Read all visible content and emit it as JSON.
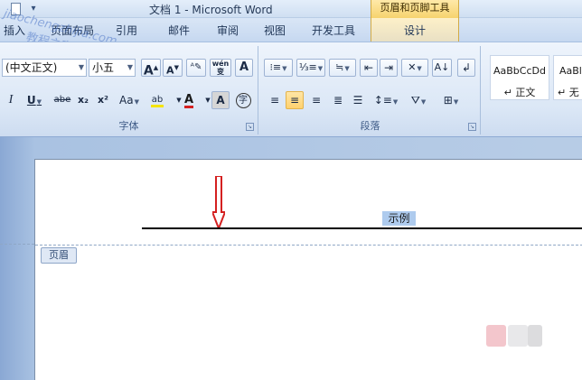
{
  "window": {
    "title": "文档 1 - Microsoft Word",
    "context_title": "页眉和页脚工具",
    "watermark_line1": "jiaochengzhijia.com",
    "watermark_line2": "教程之家"
  },
  "tabs": [
    "插入",
    "页面布局",
    "引用",
    "邮件",
    "审阅",
    "视图",
    "开发工具"
  ],
  "context_tab": "设计",
  "font_group": {
    "font_name": "(中文正文)",
    "font_size": "小五",
    "label": "字体",
    "grow_label": "A",
    "shrink_label": "A",
    "phonetic_label": "wén",
    "border_char_label": "A",
    "italic": "I",
    "underline": "U",
    "strike": "abe",
    "subscript": "x₂",
    "superscript": "x²",
    "change_case": "Aa",
    "highlight": "ab",
    "font_color": "A",
    "char_shading": "A",
    "enclose": "字"
  },
  "paragraph_group": {
    "label": "段落"
  },
  "styles_group": {
    "items": [
      {
        "sample": "AaBbCcDd",
        "name": "↵ 正文"
      },
      {
        "sample": "AaBl",
        "name": "↵ 无"
      }
    ]
  },
  "document": {
    "header_text": "示例",
    "header_tag": "页眉"
  },
  "colors": {
    "arrow": "#d42020",
    "highlight_yellow": "#f5e400",
    "font_red": "#d42020",
    "selection": "#aecbee"
  }
}
